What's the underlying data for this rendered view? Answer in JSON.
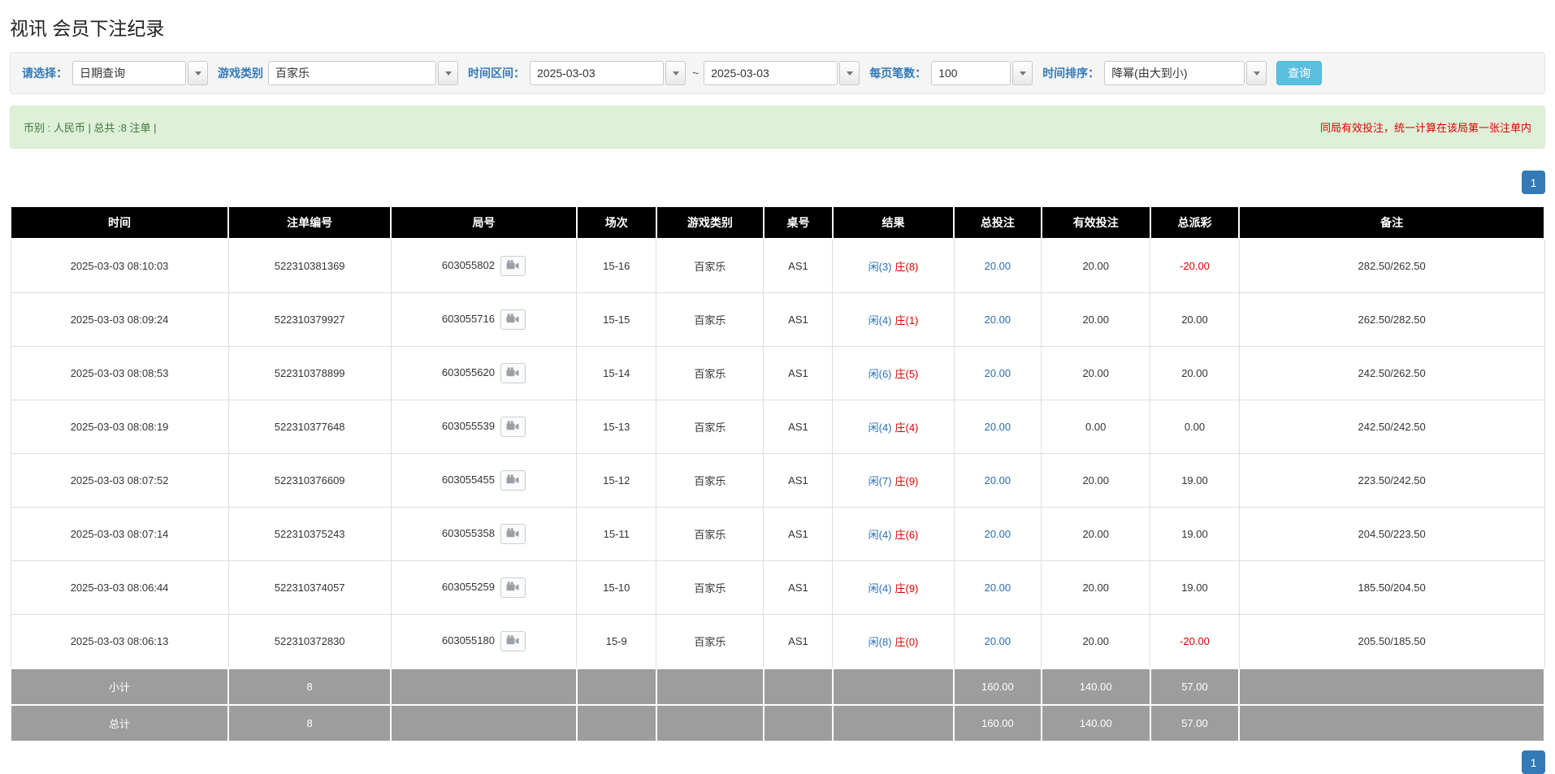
{
  "colors": {
    "accent": "#337ab7",
    "search_button": "#5bc0de",
    "header_bg": "#000000",
    "footer_bg": "#9d9d9d",
    "success_bg": "#dff0d8",
    "success_text": "#3c763d",
    "alert_red": "#dd0000",
    "link_blue": "#2a6db0"
  },
  "page": {
    "title": "视讯 会员下注纪录"
  },
  "filters": {
    "select": {
      "label": "请选择：",
      "value": "日期查询"
    },
    "game_type": {
      "label": "游戏类别",
      "value": "百家乐"
    },
    "date_range": {
      "label": "时间区间：",
      "from": "2025-03-03",
      "separator": "~",
      "to": "2025-03-03"
    },
    "page_size": {
      "label": "每页笔数：",
      "value": "100"
    },
    "sort": {
      "label": "时间排序：",
      "value": "降幂(由大到小)"
    },
    "search_button": "查询"
  },
  "summary": {
    "info": "币别 : 人民币 | 总共 :8 注单 |",
    "notice": "同局有效投注，统一计算在该局第一张注单内"
  },
  "pagination": {
    "current_page": "1"
  },
  "table": {
    "headers": [
      "时间",
      "注单编号",
      "局号",
      "场次",
      "游戏类别",
      "桌号",
      "结果",
      "总投注",
      "有效投注",
      "总派彩",
      "备注"
    ],
    "rows": [
      {
        "time": "2025-03-03 08:10:03",
        "bet_id": "522310381369",
        "round_id": "603055802",
        "session": "15-16",
        "game": "百家乐",
        "table_no": "AS1",
        "result": {
          "player": "闲(3)",
          "banker": "庄(8)"
        },
        "total_bet": "20.00",
        "valid_bet": "20.00",
        "payout": "-20.00",
        "remark": "282.50/262.50"
      },
      {
        "time": "2025-03-03 08:09:24",
        "bet_id": "522310379927",
        "round_id": "603055716",
        "session": "15-15",
        "game": "百家乐",
        "table_no": "AS1",
        "result": {
          "player": "闲(4)",
          "banker": "庄(1)"
        },
        "total_bet": "20.00",
        "valid_bet": "20.00",
        "payout": "20.00",
        "remark": "262.50/282.50"
      },
      {
        "time": "2025-03-03 08:08:53",
        "bet_id": "522310378899",
        "round_id": "603055620",
        "session": "15-14",
        "game": "百家乐",
        "table_no": "AS1",
        "result": {
          "player": "闲(6)",
          "banker": "庄(5)"
        },
        "total_bet": "20.00",
        "valid_bet": "20.00",
        "payout": "20.00",
        "remark": "242.50/262.50"
      },
      {
        "time": "2025-03-03 08:08:19",
        "bet_id": "522310377648",
        "round_id": "603055539",
        "session": "15-13",
        "game": "百家乐",
        "table_no": "AS1",
        "result": {
          "player": "闲(4)",
          "banker": "庄(4)"
        },
        "total_bet": "20.00",
        "valid_bet": "0.00",
        "payout": "0.00",
        "remark": "242.50/242.50"
      },
      {
        "time": "2025-03-03 08:07:52",
        "bet_id": "522310376609",
        "round_id": "603055455",
        "session": "15-12",
        "game": "百家乐",
        "table_no": "AS1",
        "result": {
          "player": "闲(7)",
          "banker": "庄(9)"
        },
        "total_bet": "20.00",
        "valid_bet": "20.00",
        "payout": "19.00",
        "remark": "223.50/242.50"
      },
      {
        "time": "2025-03-03 08:07:14",
        "bet_id": "522310375243",
        "round_id": "603055358",
        "session": "15-11",
        "game": "百家乐",
        "table_no": "AS1",
        "result": {
          "player": "闲(4)",
          "banker": "庄(6)"
        },
        "total_bet": "20.00",
        "valid_bet": "20.00",
        "payout": "19.00",
        "remark": "204.50/223.50"
      },
      {
        "time": "2025-03-03 08:06:44",
        "bet_id": "522310374057",
        "round_id": "603055259",
        "session": "15-10",
        "game": "百家乐",
        "table_no": "AS1",
        "result": {
          "player": "闲(4)",
          "banker": "庄(9)"
        },
        "total_bet": "20.00",
        "valid_bet": "20.00",
        "payout": "19.00",
        "remark": "185.50/204.50"
      },
      {
        "time": "2025-03-03 08:06:13",
        "bet_id": "522310372830",
        "round_id": "603055180",
        "session": "15-9",
        "game": "百家乐",
        "table_no": "AS1",
        "result": {
          "player": "闲(8)",
          "banker": "庄(0)"
        },
        "total_bet": "20.00",
        "valid_bet": "20.00",
        "payout": "-20.00",
        "remark": "205.50/185.50"
      }
    ],
    "footer_rows": [
      {
        "label": "小计",
        "count": "8",
        "total_bet": "160.00",
        "valid_bet": "140.00",
        "payout": "57.00"
      },
      {
        "label": "总计",
        "count": "8",
        "total_bet": "160.00",
        "valid_bet": "140.00",
        "payout": "57.00"
      }
    ]
  }
}
